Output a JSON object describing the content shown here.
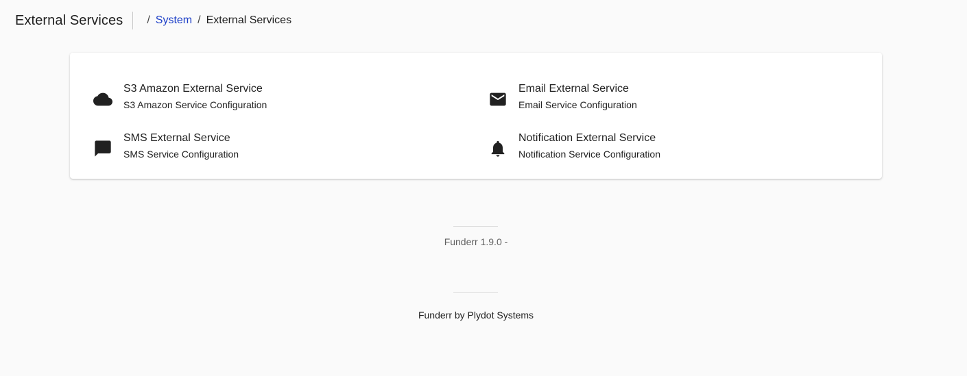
{
  "header": {
    "title": "External Services",
    "breadcrumb": {
      "separator": "/",
      "items": [
        {
          "label": "System"
        },
        {
          "label": "External Services"
        }
      ]
    }
  },
  "services": [
    {
      "icon": "cloud-icon",
      "title": "S3 Amazon External Service",
      "subtitle": "S3 Amazon Service Configuration"
    },
    {
      "icon": "email-icon",
      "title": "Email External Service",
      "subtitle": "Email Service Configuration"
    },
    {
      "icon": "sms-icon",
      "title": "SMS External Service",
      "subtitle": "SMS Service Configuration"
    },
    {
      "icon": "bell-icon",
      "title": "Notification External Service",
      "subtitle": "Notification Service Configuration"
    }
  ],
  "footer": {
    "version": "Funderr 1.9.0 -",
    "credit": "Funderr by Plydot Systems"
  },
  "colors": {
    "background": "#fafafa",
    "card": "#ffffff",
    "link": "#1e40c8",
    "text": "#212121",
    "muted": "#616161"
  }
}
